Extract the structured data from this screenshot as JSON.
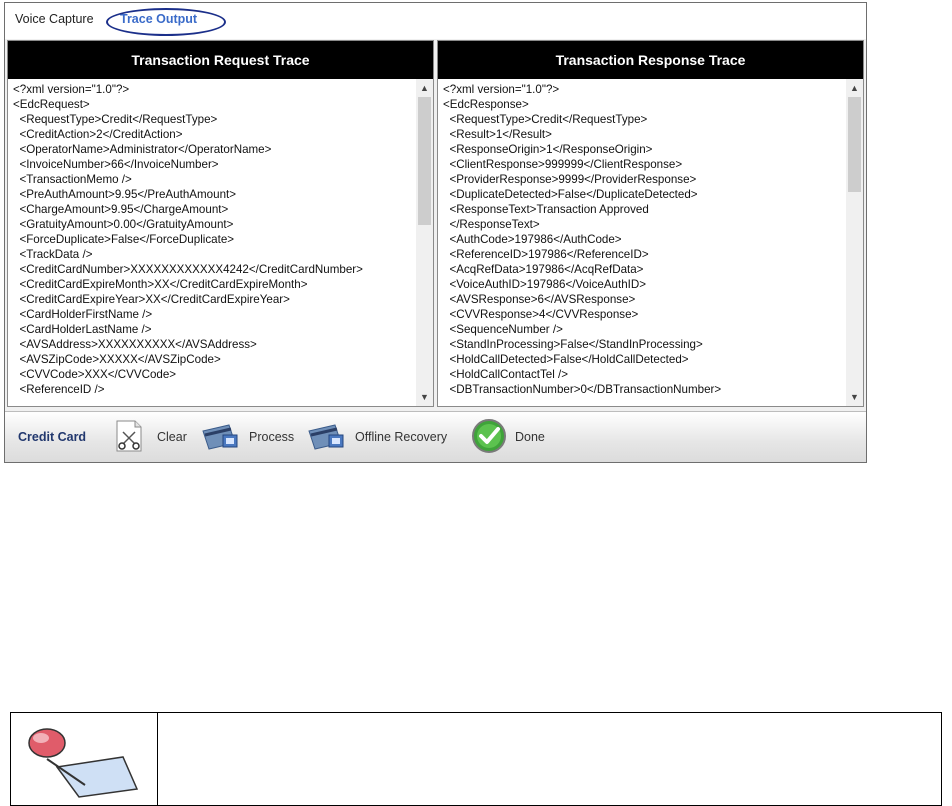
{
  "tabs": {
    "voice_capture": "Voice Capture",
    "trace_output": "Trace Output"
  },
  "request": {
    "title": "Transaction Request Trace",
    "xml": "<?xml version=\"1.0\"?>\n<EdcRequest>\n  <RequestType>Credit</RequestType>\n  <CreditAction>2</CreditAction>\n  <OperatorName>Administrator</OperatorName>\n  <InvoiceNumber>66</InvoiceNumber>\n  <TransactionMemo />\n  <PreAuthAmount>9.95</PreAuthAmount>\n  <ChargeAmount>9.95</ChargeAmount>\n  <GratuityAmount>0.00</GratuityAmount>\n  <ForceDuplicate>False</ForceDuplicate>\n  <TrackData />\n  <CreditCardNumber>XXXXXXXXXXXX4242</CreditCardNumber>\n  <CreditCardExpireMonth>XX</CreditCardExpireMonth>\n  <CreditCardExpireYear>XX</CreditCardExpireYear>\n  <CardHolderFirstName />\n  <CardHolderLastName />\n  <AVSAddress>XXXXXXXXXX</AVSAddress>\n  <AVSZipCode>XXXXX</AVSZipCode>\n  <CVVCode>XXX</CVVCode>\n  <ReferenceID />"
  },
  "response": {
    "title": "Transaction Response Trace",
    "xml": "<?xml version=\"1.0\"?>\n<EdcResponse>\n  <RequestType>Credit</RequestType>\n  <Result>1</Result>\n  <ResponseOrigin>1</ResponseOrigin>\n  <ClientResponse>999999</ClientResponse>\n  <ProviderResponse>9999</ProviderResponse>\n  <DuplicateDetected>False</DuplicateDetected>\n  <ResponseText>Transaction Approved\n  </ResponseText>\n  <AuthCode>197986</AuthCode>\n  <ReferenceID>197986</ReferenceID>\n  <AcqRefData>197986</AcqRefData>\n  <VoiceAuthID>197986</VoiceAuthID>\n  <AVSResponse>6</AVSResponse>\n  <CVVResponse>4</CVVResponse>\n  <SequenceNumber />\n  <StandInProcessing>False</StandInProcessing>\n  <HoldCallDetected>False</HoldCallDetected>\n  <HoldCallContactTel />\n  <DBTransactionNumber>0</DBTransactionNumber>"
  },
  "toolbar": {
    "label": "Credit Card",
    "clear": "Clear",
    "process": "Process",
    "offline": "Offline Recovery",
    "done": "Done"
  },
  "icons": {
    "clear": "scissors-clipboard-icon",
    "process": "card-process-icon",
    "offline": "card-offline-icon",
    "done": "checkmark-icon",
    "note": "pushpin-note-icon"
  },
  "colors": {
    "header_bg": "#000000",
    "active_tab": "#3a6bc9",
    "toolbar_label": "#22386e",
    "done_green": "#3fa33a"
  }
}
